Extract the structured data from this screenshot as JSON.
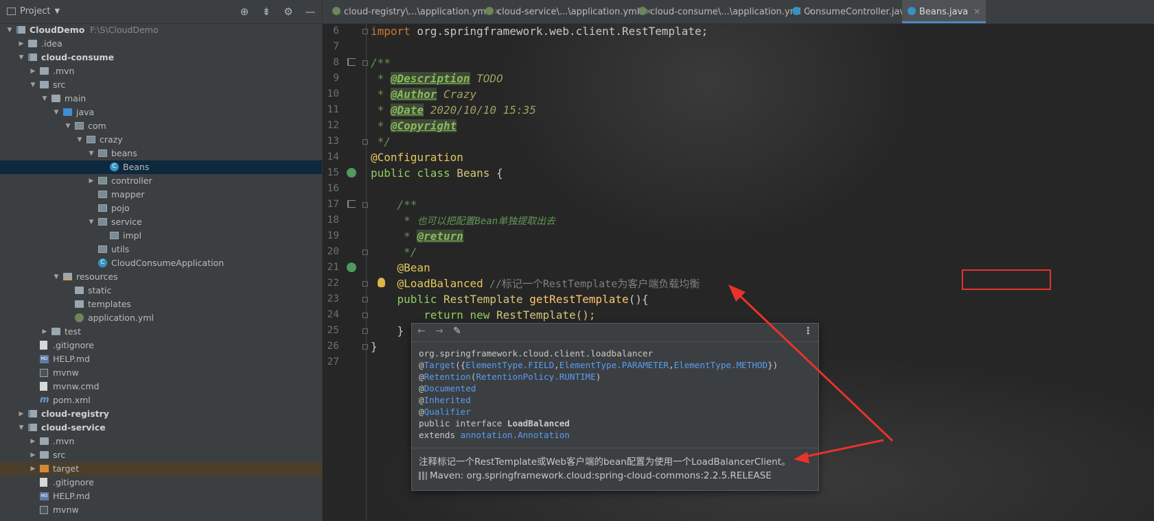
{
  "project_panel": {
    "title": "Project",
    "tools": [
      "target-icon",
      "collapse-icon",
      "gear-icon",
      "minimize-icon"
    ],
    "tree": [
      {
        "label": "CloudDemo",
        "path": "F:\\S\\CloudDemo",
        "depth": 0,
        "expanded": true,
        "icon": "module",
        "bold": true
      },
      {
        "label": ".idea",
        "depth": 1,
        "expanded": false,
        "icon": "folder"
      },
      {
        "label": "cloud-consume",
        "depth": 1,
        "expanded": true,
        "icon": "module",
        "bold": true
      },
      {
        "label": ".mvn",
        "depth": 2,
        "expanded": false,
        "icon": "folder"
      },
      {
        "label": "src",
        "depth": 2,
        "expanded": true,
        "icon": "folder"
      },
      {
        "label": "main",
        "depth": 3,
        "expanded": true,
        "icon": "folder"
      },
      {
        "label": "java",
        "depth": 4,
        "expanded": true,
        "icon": "folder-src"
      },
      {
        "label": "com",
        "depth": 5,
        "expanded": true,
        "icon": "pkg"
      },
      {
        "label": "crazy",
        "depth": 6,
        "expanded": true,
        "icon": "pkg"
      },
      {
        "label": "beans",
        "depth": 7,
        "expanded": true,
        "icon": "pkg"
      },
      {
        "label": "Beans",
        "depth": 8,
        "icon": "cls",
        "selected": true
      },
      {
        "label": "controller",
        "depth": 7,
        "expanded": false,
        "icon": "pkg"
      },
      {
        "label": "mapper",
        "depth": 7,
        "icon": "pkg"
      },
      {
        "label": "pojo",
        "depth": 7,
        "icon": "pkg"
      },
      {
        "label": "service",
        "depth": 7,
        "expanded": true,
        "icon": "pkg"
      },
      {
        "label": "impl",
        "depth": 8,
        "icon": "pkg"
      },
      {
        "label": "utils",
        "depth": 7,
        "icon": "pkg"
      },
      {
        "label": "CloudConsumeApplication",
        "depth": 7,
        "icon": "cls"
      },
      {
        "label": "resources",
        "depth": 4,
        "expanded": true,
        "icon": "folder-res"
      },
      {
        "label": "static",
        "depth": 5,
        "icon": "folder"
      },
      {
        "label": "templates",
        "depth": 5,
        "icon": "folder"
      },
      {
        "label": "application.yml",
        "depth": 5,
        "icon": "yml"
      },
      {
        "label": "test",
        "depth": 3,
        "expanded": false,
        "icon": "folder"
      },
      {
        "label": ".gitignore",
        "depth": 2,
        "icon": "file"
      },
      {
        "label": "HELP.md",
        "depth": 2,
        "icon": "md"
      },
      {
        "label": "mvnw",
        "depth": 2,
        "icon": "term"
      },
      {
        "label": "mvnw.cmd",
        "depth": 2,
        "icon": "file"
      },
      {
        "label": "pom.xml",
        "depth": 2,
        "icon": "maven"
      },
      {
        "label": "cloud-registry",
        "depth": 1,
        "expanded": false,
        "icon": "module",
        "bold": true
      },
      {
        "label": "cloud-service",
        "depth": 1,
        "expanded": true,
        "icon": "module",
        "bold": true
      },
      {
        "label": ".mvn",
        "depth": 2,
        "expanded": false,
        "icon": "folder"
      },
      {
        "label": "src",
        "depth": 2,
        "expanded": false,
        "icon": "folder"
      },
      {
        "label": "target",
        "depth": 2,
        "expanded": false,
        "icon": "folder-orange",
        "highlight": true
      },
      {
        "label": ".gitignore",
        "depth": 2,
        "icon": "file"
      },
      {
        "label": "HELP.md",
        "depth": 2,
        "icon": "md"
      },
      {
        "label": "mvnw",
        "depth": 2,
        "icon": "term"
      }
    ]
  },
  "tabs": [
    {
      "label": "cloud-registry\\...\\application.yml",
      "icon": "yml"
    },
    {
      "label": "cloud-service\\...\\application.yml",
      "icon": "yml"
    },
    {
      "label": "cloud-consume\\...\\application.yml",
      "icon": "yml"
    },
    {
      "label": "ConsumeController.java",
      "icon": "cls"
    },
    {
      "label": "Beans.java",
      "icon": "cls",
      "active": true
    }
  ],
  "editor": {
    "line_numbers": [
      "6",
      "7",
      "8",
      "9",
      "10",
      "11",
      "12",
      "13",
      "14",
      "15",
      "16",
      "17",
      "18",
      "19",
      "20",
      "21",
      "22",
      "23",
      "24",
      "25",
      "26",
      "27"
    ],
    "code": {
      "l6_kw": "import",
      "l6_rest": " org.springframework.web.client.RestTemplate;",
      "l8": "/**",
      "l9_pre": " * ",
      "l9_tag": "@Description",
      "l9_val": " TODO",
      "l10_pre": " * ",
      "l10_tag": "@Author",
      "l10_val": " Crazy",
      "l11_pre": " * ",
      "l11_tag": "@Date",
      "l11_val": " 2020/10/10 15:35",
      "l12_pre": " * ",
      "l12_tag": "@Copyright",
      "l13": " */",
      "l14": "@Configuration",
      "l15_kw": "public class ",
      "l15_name": "Beans",
      "l15_brace": " {",
      "l17": "    /**",
      "l18_pre": "     * ",
      "l18_text": "也可以把配置Bean单独提取出去",
      "l19_pre": "     * ",
      "l19_tag": "@return",
      "l20": "     */",
      "l21": "    @Bean",
      "l22_ann": "    @LoadBalanced",
      "l22_cm": " //标记一个RestTemplate为客户端负载均衡",
      "l23_kw": "    public ",
      "l23_type": "RestTemplate",
      "l23_fn": " getRestTemplate",
      "l23_rest": "(){",
      "l24_kw": "        return new ",
      "l24_rest": "RestTemplate();",
      "l25": "    }",
      "l26": "}"
    }
  },
  "quick_doc": {
    "toolbar": [
      "back-arrow-icon",
      "forward-arrow-icon",
      "edit-source-icon",
      "more-menu-icon"
    ],
    "package": "org.springframework.cloud.client.loadbalancer",
    "target_at": "@",
    "target_name": "Target",
    "target_args_open": "({",
    "target_a1": "ElementType.FIELD",
    "target_comma": ",",
    "target_a2": "ElementType.PARAMETER",
    "target_a3": "ElementType.METHOD",
    "target_args_close": "})",
    "retention_name": "Retention",
    "retention_open": "(",
    "retention_arg": "RetentionPolicy.RUNTIME",
    "retention_close": ")",
    "documented": "Documented",
    "inherited": "Inherited",
    "qualifier": "Qualifier",
    "decl_prefix": "public interface ",
    "decl_name": "LoadBalanced",
    "extends_prefix": "extends ",
    "extends_name": "annotation.Annotation",
    "description": "注释标记一个RestTemplate或Web客户端的bean配置为使用一个LoadBalancerClient。",
    "maven": "Maven: org.springframework.cloud:spring-cloud-commons:2.2.5.RELEASE"
  },
  "colors": {
    "annotation_box": "#e8332a",
    "accent": "#4a88c7"
  }
}
